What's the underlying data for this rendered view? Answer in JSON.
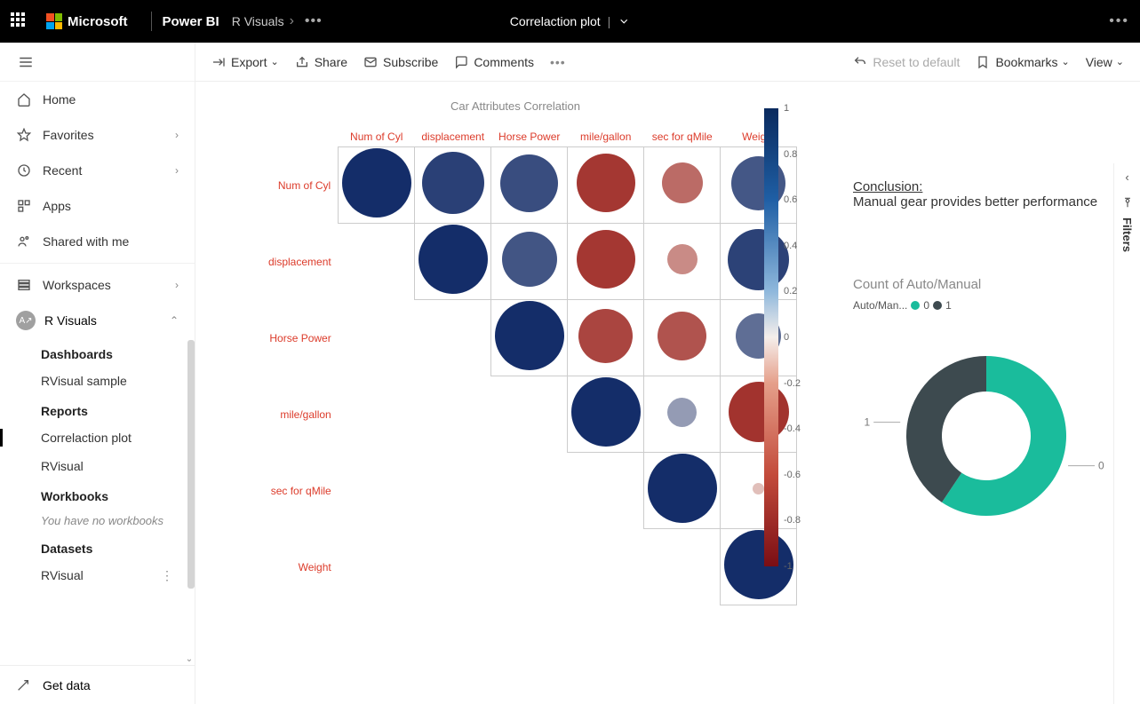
{
  "header": {
    "microsoft": "Microsoft",
    "product": "Power BI",
    "breadcrumb": "R Visuals",
    "report_title": "Correlaction plot"
  },
  "toolbar": {
    "export": "Export",
    "share": "Share",
    "subscribe": "Subscribe",
    "comments": "Comments",
    "reset": "Reset to default",
    "bookmarks": "Bookmarks",
    "view": "View"
  },
  "sidebar": {
    "home": "Home",
    "favorites": "Favorites",
    "recent": "Recent",
    "apps": "Apps",
    "shared": "Shared with me",
    "workspaces": "Workspaces",
    "ws_name": "R Visuals",
    "dashboards": "Dashboards",
    "rvisual_sample": "RVisual sample",
    "reports": "Reports",
    "correlation_plot": "Correlaction plot",
    "rvisual": "RVisual",
    "workbooks": "Workbooks",
    "no_workbooks": "You have no workbooks",
    "datasets": "Datasets",
    "rvisual2": "RVisual",
    "get_data": "Get data"
  },
  "filters_label": "Filters",
  "conclusion": {
    "heading": "Conclusion: ",
    "body": "Manual gear provides better performance"
  },
  "donut": {
    "title": "Count of Auto/Manual",
    "legend_field": "Auto/Man...",
    "cat0": "0",
    "cat1": "1",
    "lbl0": "0",
    "lbl1": "1"
  },
  "chart_data": [
    {
      "type": "heatmap",
      "title": "Car Attributes Correlation",
      "variables": [
        "Num of Cyl",
        "displacement",
        "Horse Power",
        "mile/gallon",
        "sec for qMile",
        "Weight"
      ],
      "matrix_upper_triangle_including_diag": [
        [
          1.0,
          0.9,
          0.83,
          -0.85,
          -0.59,
          0.78
        ],
        [
          null,
          1.0,
          0.79,
          -0.85,
          -0.43,
          0.89
        ],
        [
          null,
          null,
          1.0,
          -0.78,
          -0.71,
          0.66
        ],
        [
          null,
          null,
          null,
          1.0,
          0.42,
          -0.87
        ],
        [
          null,
          null,
          null,
          null,
          1.0,
          -0.17
        ],
        [
          null,
          null,
          null,
          null,
          null,
          1.0
        ]
      ],
      "colorbar": {
        "min": -1,
        "max": 1,
        "ticks": [
          1,
          0.8,
          0.6,
          0.4,
          0.2,
          0,
          -0.2,
          -0.4,
          -0.6,
          -0.8,
          -1
        ]
      }
    },
    {
      "type": "pie",
      "title": "Count of Auto/Manual",
      "series_field": "Auto/Manual",
      "categories": [
        "0",
        "1"
      ],
      "values": [
        19,
        13
      ],
      "colors": {
        "0": "#1abc9c",
        "1": "#3d4a4f"
      },
      "donut": true
    }
  ]
}
